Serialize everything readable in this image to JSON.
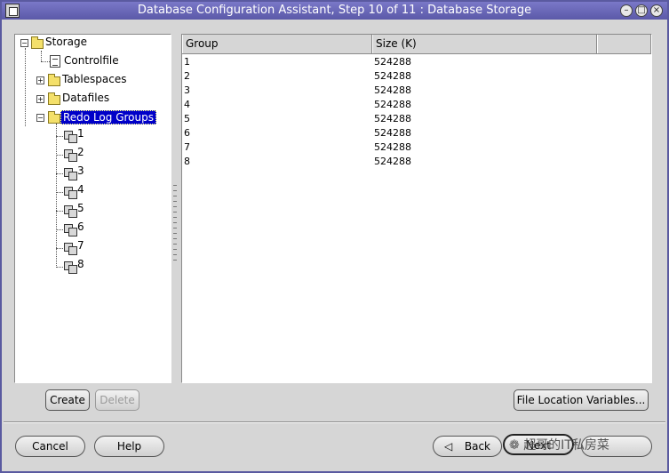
{
  "window": {
    "title": "Database Configuration Assistant, Step 10 of 11 : Database Storage"
  },
  "tree": {
    "root": "Storage",
    "items": {
      "controlfile": "Controlfile",
      "tablespaces": "Tablespaces",
      "datafiles": "Datafiles",
      "redo_log_groups": "Redo Log Groups"
    },
    "redo_groups": [
      "1",
      "2",
      "3",
      "4",
      "5",
      "6",
      "7",
      "8"
    ]
  },
  "table": {
    "columns": [
      "Group",
      "Size (K)"
    ],
    "rows": [
      [
        "1",
        "524288"
      ],
      [
        "2",
        "524288"
      ],
      [
        "3",
        "524288"
      ],
      [
        "4",
        "524288"
      ],
      [
        "5",
        "524288"
      ],
      [
        "6",
        "524288"
      ],
      [
        "7",
        "524288"
      ],
      [
        "8",
        "524288"
      ]
    ]
  },
  "buttons": {
    "create": "Create",
    "delete": "Delete",
    "file_location_variables": "File Location Variables...",
    "cancel": "Cancel",
    "help": "Help",
    "back": "Back",
    "next": "Next"
  },
  "watermark": "超哥的IT私房菜"
}
